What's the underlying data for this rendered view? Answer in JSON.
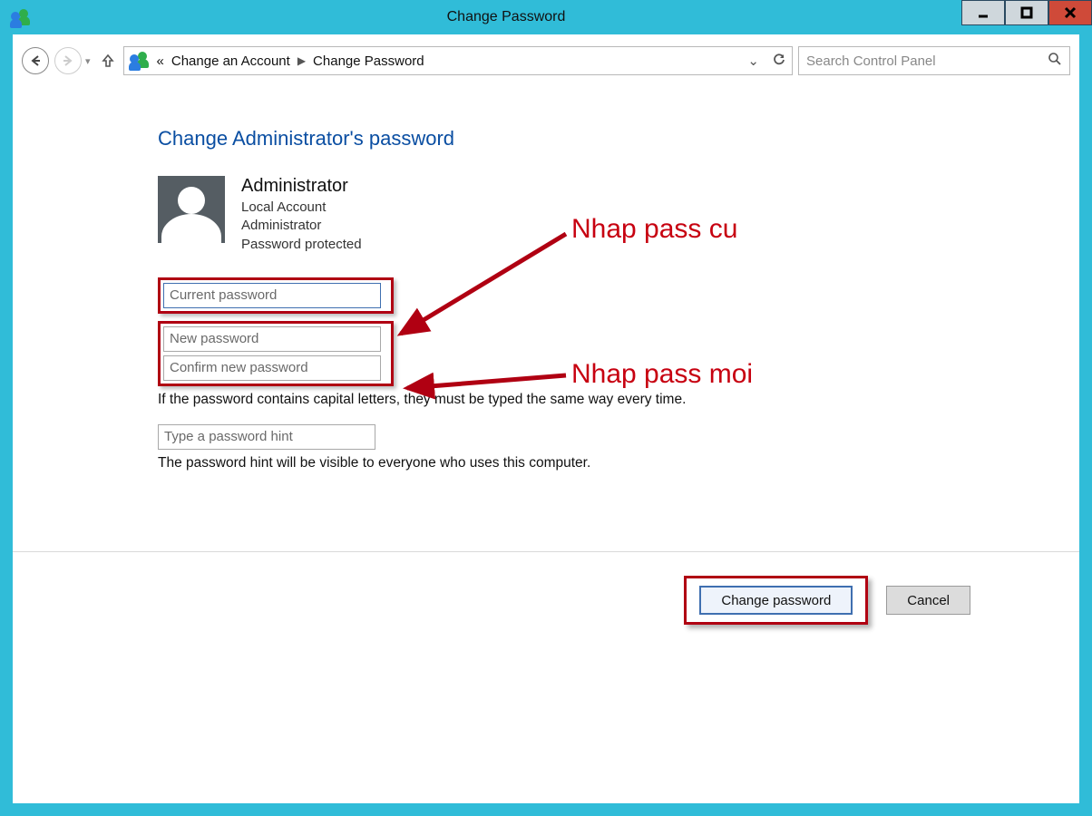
{
  "window": {
    "title": "Change Password"
  },
  "nav": {
    "breadcrumb_prefix": "«",
    "breadcrumb_parent": "Change an Account",
    "breadcrumb_current": "Change Password",
    "search_placeholder": "Search Control Panel"
  },
  "page": {
    "heading": "Change Administrator's password",
    "user": {
      "name": "Administrator",
      "line1": "Local Account",
      "line2": "Administrator",
      "line3": "Password protected"
    },
    "fields": {
      "current_placeholder": "Current password",
      "new_placeholder": "New password",
      "confirm_placeholder": "Confirm new password",
      "hint_placeholder": "Type a password hint"
    },
    "help_capitals": "If the password contains capital letters, they must be typed the same way every time.",
    "help_hint": "The password hint will be visible to everyone who uses this computer."
  },
  "buttons": {
    "change": "Change password",
    "cancel": "Cancel"
  },
  "annotations": {
    "old_pass": "Nhap pass cu",
    "new_pass": "Nhap pass moi"
  }
}
